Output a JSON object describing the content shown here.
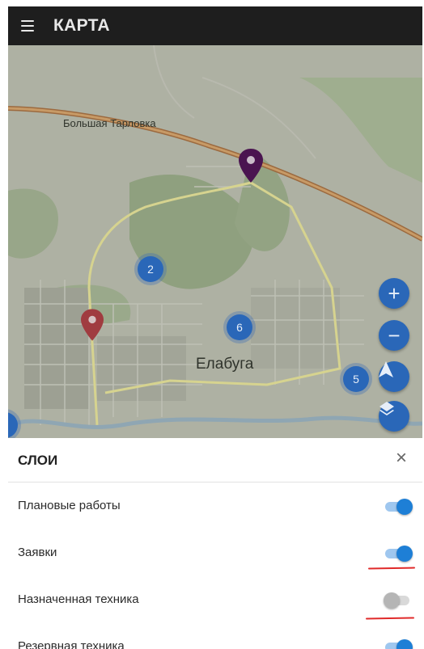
{
  "appbar": {
    "title": "КАРТА",
    "menu_icon": "hamburger-menu-icon"
  },
  "map": {
    "labels": {
      "village": "Большая Тарловка",
      "city": "Елабуга"
    },
    "clusters": [
      {
        "count": "2"
      },
      {
        "count": "6"
      },
      {
        "count": "5"
      }
    ],
    "markers": [
      {
        "name": "purple-pin",
        "color": "#4a1450"
      },
      {
        "name": "red-pin",
        "color": "#a03c40"
      }
    ],
    "controls": {
      "zoom_in": "+",
      "zoom_out": "−",
      "icons": [
        "zoom-in-icon",
        "zoom-out-icon",
        "navigation-arrow-icon",
        "layers-icon"
      ]
    }
  },
  "layers_panel": {
    "title": "СЛОИ",
    "close": "×",
    "items": [
      {
        "label": "Плановые работы",
        "enabled": true
      },
      {
        "label": "Заявки",
        "enabled": true
      },
      {
        "label": "Назначенная техника",
        "enabled": false
      },
      {
        "label": "Резервная техника",
        "enabled": true
      }
    ]
  },
  "colors": {
    "accent": "#1e7fd6",
    "cluster": "#2a67b8",
    "annotation": "#e02a2a",
    "appbar": "#1e1e1e"
  }
}
